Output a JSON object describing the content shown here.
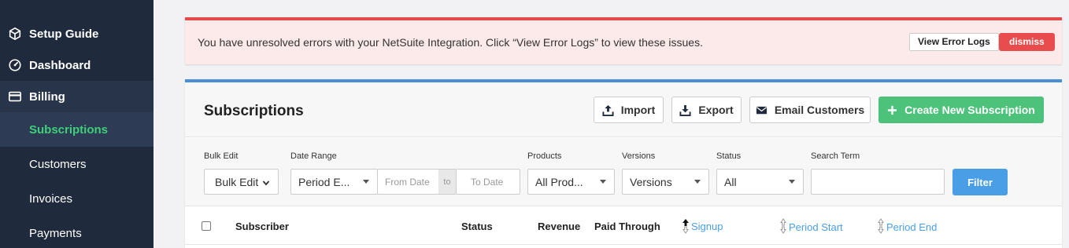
{
  "sidebar": {
    "items": [
      {
        "label": "Setup Guide",
        "icon": "cube-icon"
      },
      {
        "label": "Dashboard",
        "icon": "gauge-icon"
      },
      {
        "label": "Billing",
        "icon": "credit-card-icon"
      }
    ],
    "billing_subitems": [
      {
        "label": "Subscriptions",
        "active": true
      },
      {
        "label": "Customers"
      },
      {
        "label": "Invoices"
      },
      {
        "label": "Payments"
      }
    ]
  },
  "banner": {
    "message": "You have unresolved errors with your NetSuite Integration. Click “View Error Logs” to view these issues.",
    "view_logs_label": "View Error Logs",
    "dismiss_label": "dismiss"
  },
  "panel": {
    "title": "Subscriptions",
    "import_label": "Import",
    "export_label": "Export",
    "email_label": "Email Customers",
    "create_label": "Create New Subscription"
  },
  "filters": {
    "bulk_edit_label": "Bulk Edit",
    "bulk_edit_value": "Bulk Edit",
    "date_range_label": "Date Range",
    "date_range_value": "Period E...",
    "from_date_placeholder": "From Date",
    "to_label": "to",
    "to_date_placeholder": "To Date",
    "products_label": "Products",
    "products_value": "All Prod...",
    "versions_label": "Versions",
    "versions_value": "Versions",
    "status_label": "Status",
    "status_value": "All",
    "search_label": "Search Term",
    "search_value": "",
    "filter_button": "Filter"
  },
  "table": {
    "columns": {
      "subscriber": "Subscriber",
      "status": "Status",
      "revenue": "Revenue",
      "paid_through": "Paid Through",
      "signup": "Signup",
      "period_start": "Period Start",
      "period_end": "Period End"
    }
  },
  "colors": {
    "sidebar_bg": "#1f2a3d",
    "active_nav": "#3ecf7a",
    "banner_border": "#e34a4a",
    "primary_blue": "#4a9ee6",
    "create_green": "#4cc27a"
  }
}
